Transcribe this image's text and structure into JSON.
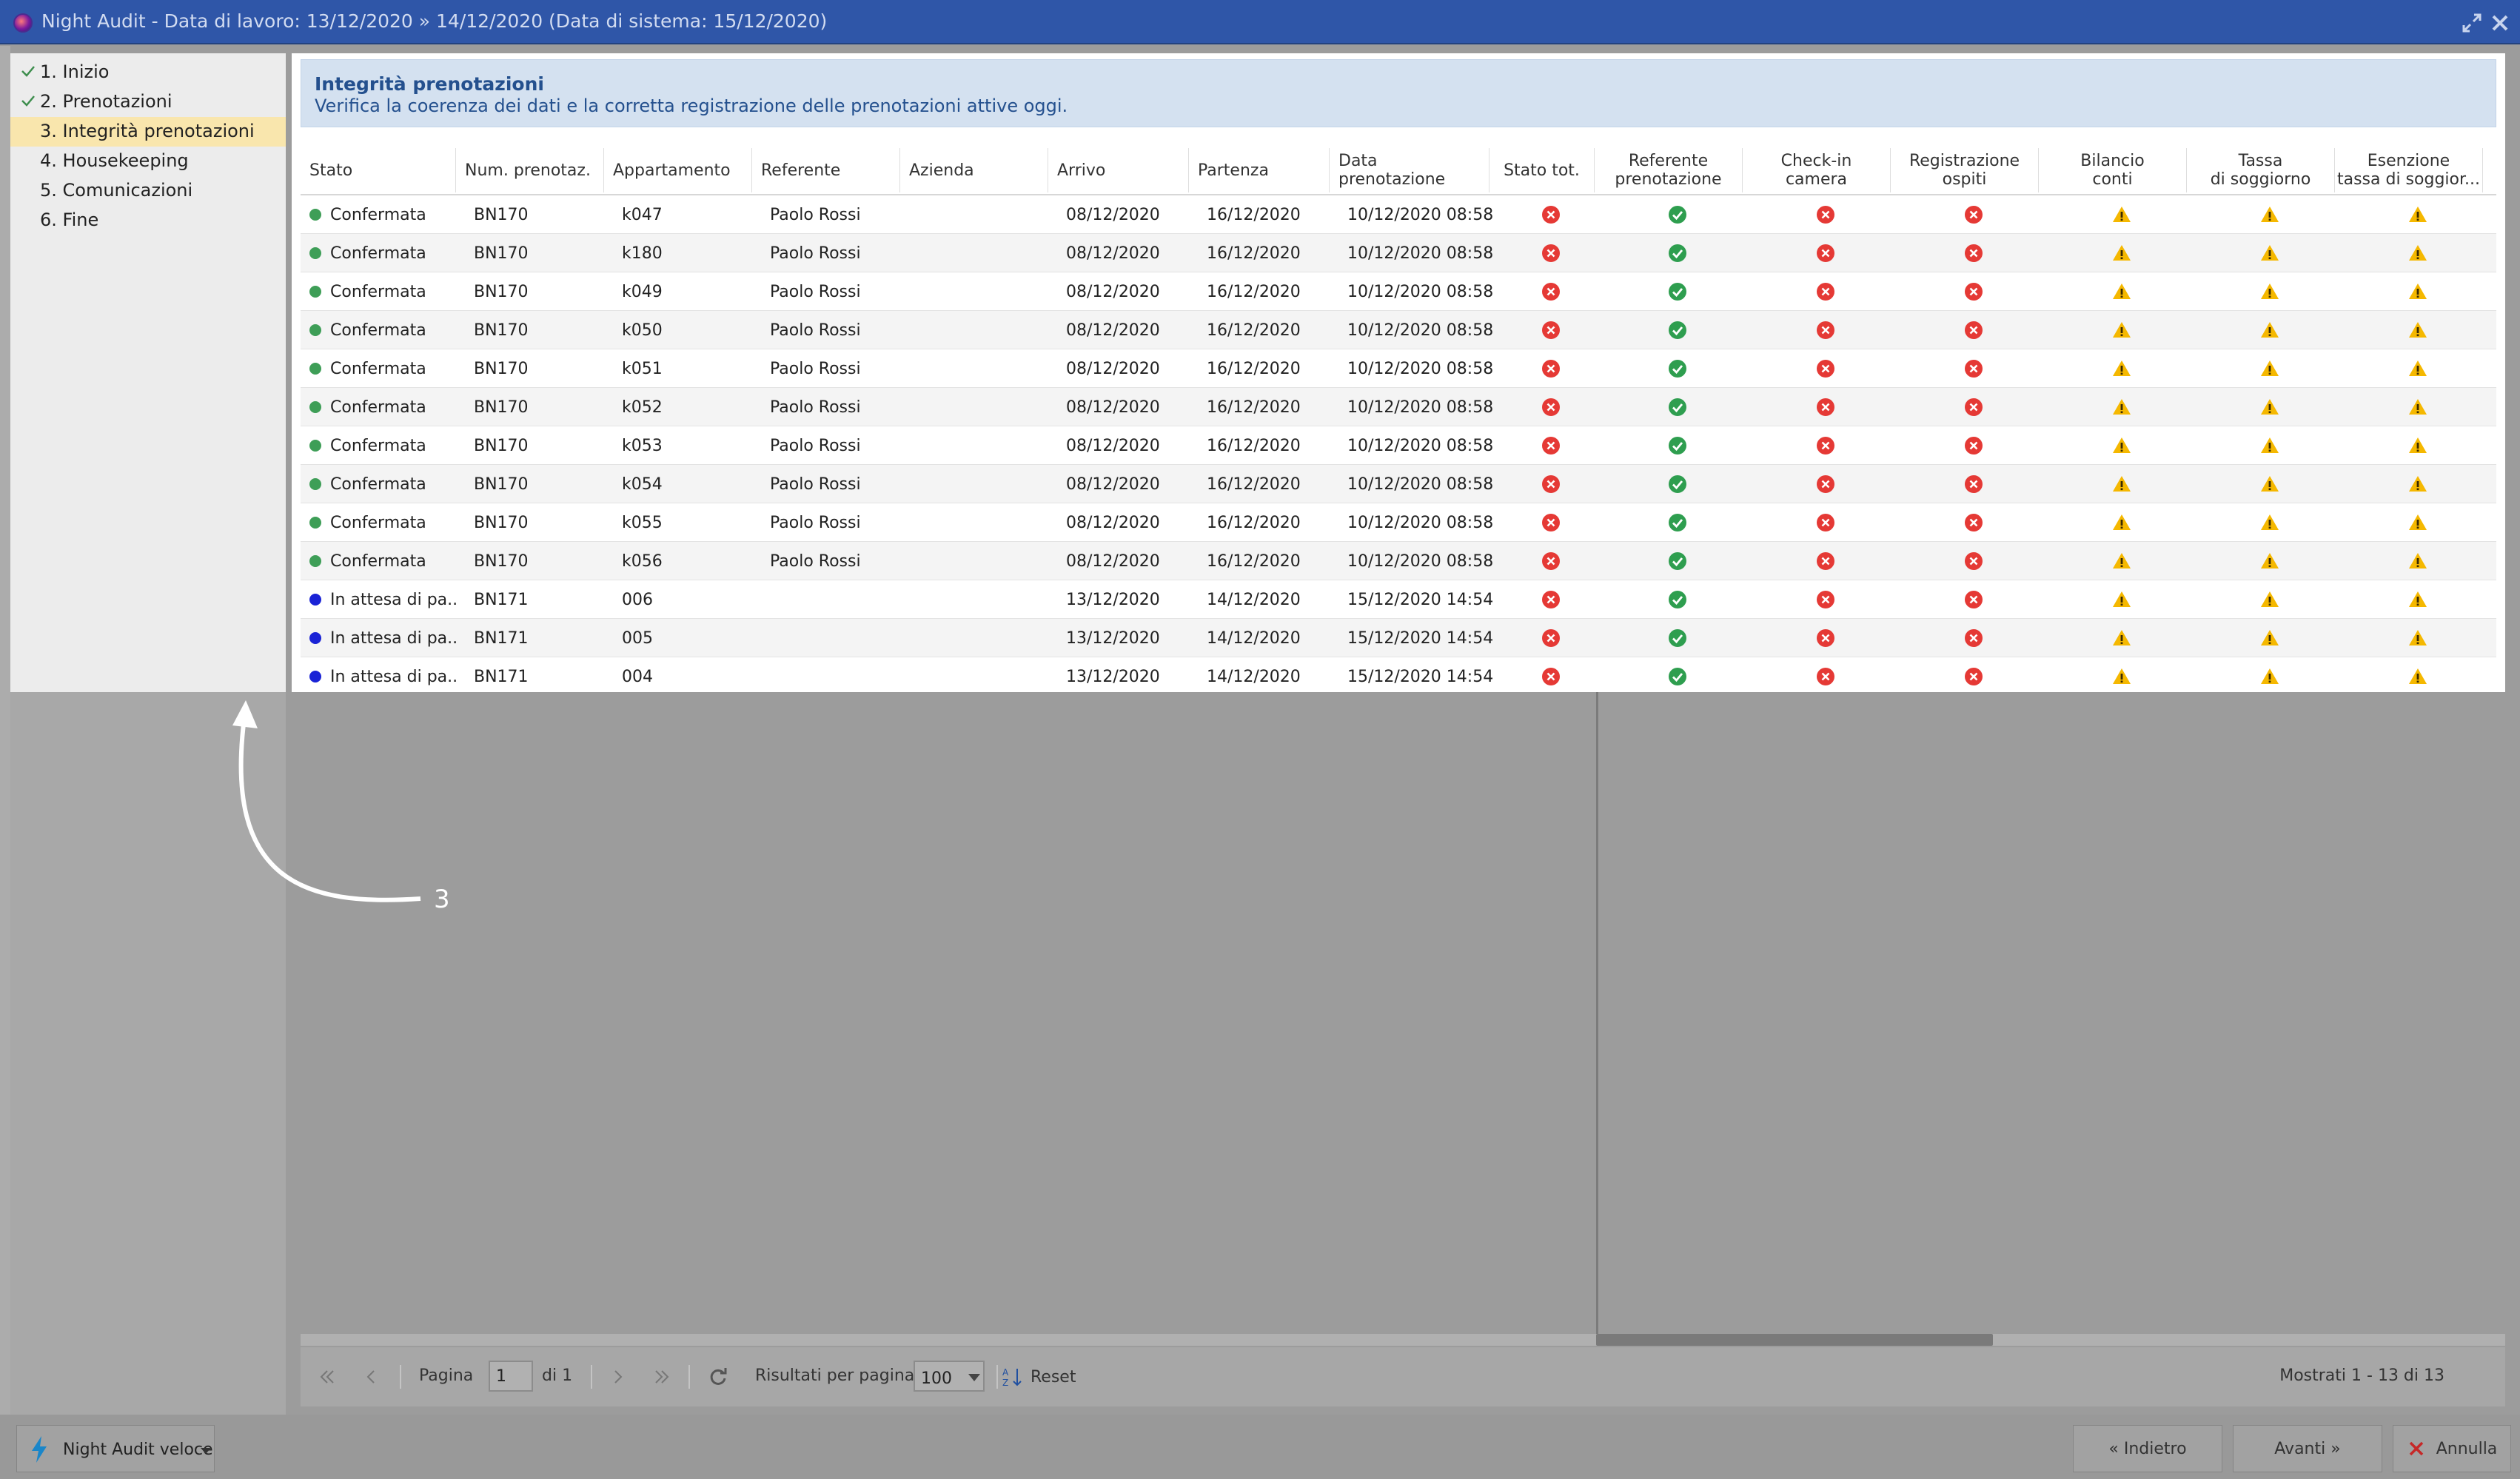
{
  "window": {
    "title": "Night Audit - Data di lavoro: 13/12/2020 » 14/12/2020 (Data di sistema: 15/12/2020)"
  },
  "sidebar": {
    "steps": [
      {
        "label": "1. Inizio",
        "done": true
      },
      {
        "label": "2. Prenotazioni",
        "done": true
      },
      {
        "label": "3. Integrità prenotazioni",
        "active": true
      },
      {
        "label": "4. Housekeeping"
      },
      {
        "label": "5. Comunicazioni"
      },
      {
        "label": "6. Fine"
      }
    ]
  },
  "info": {
    "title": "Integrità prenotazioni",
    "description": "Verifica la coerenza dei dati e la corretta registrazione delle prenotazioni attive oggi."
  },
  "table": {
    "headers": {
      "stato": "Stato",
      "num": "Num. prenotaz.",
      "appartamento": "Appartamento",
      "referente": "Referente",
      "azienda": "Azienda",
      "arrivo": "Arrivo",
      "partenza": "Partenza",
      "data_pren": "Data prenotazione",
      "stato_tot": "Stato tot.",
      "ref_pren": "Referente\nprenotazione",
      "checkin": "Check-in\ncamera",
      "reg_ospiti": "Registrazione\nospiti",
      "bilancio": "Bilancio\nconti",
      "tassa": "Tassa\ndi soggiorno",
      "esenzione": "Esenzione\ntassa di soggior..."
    },
    "rows": [
      {
        "stato": "Confermata",
        "stato_color": "#3e9e57",
        "num": "BN170",
        "appartamento": "k047",
        "referente": "Paolo Rossi",
        "azienda": "",
        "arrivo": "08/12/2020",
        "partenza": "16/12/2020",
        "data_pren": "10/12/2020 08:58",
        "stato_tot": "error",
        "ref_pren": "ok",
        "checkin": "error",
        "reg_ospiti": "error",
        "bilancio": "warning",
        "tassa": "warning",
        "esenzione": "warning"
      },
      {
        "stato": "Confermata",
        "stato_color": "#3e9e57",
        "num": "BN170",
        "appartamento": "k180",
        "referente": "Paolo Rossi",
        "azienda": "",
        "arrivo": "08/12/2020",
        "partenza": "16/12/2020",
        "data_pren": "10/12/2020 08:58",
        "stato_tot": "error",
        "ref_pren": "ok",
        "checkin": "error",
        "reg_ospiti": "error",
        "bilancio": "warning",
        "tassa": "warning",
        "esenzione": "warning"
      },
      {
        "stato": "Confermata",
        "stato_color": "#3e9e57",
        "num": "BN170",
        "appartamento": "k049",
        "referente": "Paolo Rossi",
        "azienda": "",
        "arrivo": "08/12/2020",
        "partenza": "16/12/2020",
        "data_pren": "10/12/2020 08:58",
        "stato_tot": "error",
        "ref_pren": "ok",
        "checkin": "error",
        "reg_ospiti": "error",
        "bilancio": "warning",
        "tassa": "warning",
        "esenzione": "warning"
      },
      {
        "stato": "Confermata",
        "stato_color": "#3e9e57",
        "num": "BN170",
        "appartamento": "k050",
        "referente": "Paolo Rossi",
        "azienda": "",
        "arrivo": "08/12/2020",
        "partenza": "16/12/2020",
        "data_pren": "10/12/2020 08:58",
        "stato_tot": "error",
        "ref_pren": "ok",
        "checkin": "error",
        "reg_ospiti": "error",
        "bilancio": "warning",
        "tassa": "warning",
        "esenzione": "warning"
      },
      {
        "stato": "Confermata",
        "stato_color": "#3e9e57",
        "num": "BN170",
        "appartamento": "k051",
        "referente": "Paolo Rossi",
        "azienda": "",
        "arrivo": "08/12/2020",
        "partenza": "16/12/2020",
        "data_pren": "10/12/2020 08:58",
        "stato_tot": "error",
        "ref_pren": "ok",
        "checkin": "error",
        "reg_ospiti": "error",
        "bilancio": "warning",
        "tassa": "warning",
        "esenzione": "warning"
      },
      {
        "stato": "Confermata",
        "stato_color": "#3e9e57",
        "num": "BN170",
        "appartamento": "k052",
        "referente": "Paolo Rossi",
        "azienda": "",
        "arrivo": "08/12/2020",
        "partenza": "16/12/2020",
        "data_pren": "10/12/2020 08:58",
        "stato_tot": "error",
        "ref_pren": "ok",
        "checkin": "error",
        "reg_ospiti": "error",
        "bilancio": "warning",
        "tassa": "warning",
        "esenzione": "warning"
      },
      {
        "stato": "Confermata",
        "stato_color": "#3e9e57",
        "num": "BN170",
        "appartamento": "k053",
        "referente": "Paolo Rossi",
        "azienda": "",
        "arrivo": "08/12/2020",
        "partenza": "16/12/2020",
        "data_pren": "10/12/2020 08:58",
        "stato_tot": "error",
        "ref_pren": "ok",
        "checkin": "error",
        "reg_ospiti": "error",
        "bilancio": "warning",
        "tassa": "warning",
        "esenzione": "warning"
      },
      {
        "stato": "Confermata",
        "stato_color": "#3e9e57",
        "num": "BN170",
        "appartamento": "k054",
        "referente": "Paolo Rossi",
        "azienda": "",
        "arrivo": "08/12/2020",
        "partenza": "16/12/2020",
        "data_pren": "10/12/2020 08:58",
        "stato_tot": "error",
        "ref_pren": "ok",
        "checkin": "error",
        "reg_ospiti": "error",
        "bilancio": "warning",
        "tassa": "warning",
        "esenzione": "warning"
      },
      {
        "stato": "Confermata",
        "stato_color": "#3e9e57",
        "num": "BN170",
        "appartamento": "k055",
        "referente": "Paolo Rossi",
        "azienda": "",
        "arrivo": "08/12/2020",
        "partenza": "16/12/2020",
        "data_pren": "10/12/2020 08:58",
        "stato_tot": "error",
        "ref_pren": "ok",
        "checkin": "error",
        "reg_ospiti": "error",
        "bilancio": "warning",
        "tassa": "warning",
        "esenzione": "warning"
      },
      {
        "stato": "Confermata",
        "stato_color": "#3e9e57",
        "num": "BN170",
        "appartamento": "k056",
        "referente": "Paolo Rossi",
        "azienda": "",
        "arrivo": "08/12/2020",
        "partenza": "16/12/2020",
        "data_pren": "10/12/2020 08:58",
        "stato_tot": "error",
        "ref_pren": "ok",
        "checkin": "error",
        "reg_ospiti": "error",
        "bilancio": "warning",
        "tassa": "warning",
        "esenzione": "warning"
      },
      {
        "stato": "In attesa di pa...",
        "stato_color": "#1a23d6",
        "num": "BN171",
        "appartamento": "006",
        "referente": "",
        "azienda": "",
        "arrivo": "13/12/2020",
        "partenza": "14/12/2020",
        "data_pren": "15/12/2020 14:54",
        "stato_tot": "error",
        "ref_pren": "ok",
        "checkin": "error",
        "reg_ospiti": "error",
        "bilancio": "warning",
        "tassa": "warning",
        "esenzione": "warning"
      },
      {
        "stato": "In attesa di pa...",
        "stato_color": "#1a23d6",
        "num": "BN171",
        "appartamento": "005",
        "referente": "",
        "azienda": "",
        "arrivo": "13/12/2020",
        "partenza": "14/12/2020",
        "data_pren": "15/12/2020 14:54",
        "stato_tot": "error",
        "ref_pren": "ok",
        "checkin": "error",
        "reg_ospiti": "error",
        "bilancio": "warning",
        "tassa": "warning",
        "esenzione": "warning"
      },
      {
        "stato": "In attesa di pa...",
        "stato_color": "#1a23d6",
        "num": "BN171",
        "appartamento": "004",
        "referente": "",
        "azienda": "",
        "arrivo": "13/12/2020",
        "partenza": "14/12/2020",
        "data_pren": "15/12/2020 14:54",
        "stato_tot": "error",
        "ref_pren": "ok",
        "checkin": "error",
        "reg_ospiti": "error",
        "bilancio": "warning",
        "tassa": "warning",
        "esenzione": "warning"
      }
    ]
  },
  "pager": {
    "page_label": "Pagina",
    "page_value": "1",
    "of_label": "di 1",
    "per_page_label": "Risultati per pagina",
    "per_page_value": "100",
    "reset_label": "Reset",
    "summary": "Mostrati 1 - 13 di 13"
  },
  "footer": {
    "quick_label": "Night Audit veloce",
    "back_label": "« Indietro",
    "next_label": "Avanti »",
    "cancel_label": "Annulla"
  },
  "callout": {
    "number": "3"
  },
  "colors": {
    "titlebar": "#2f56a8",
    "active_step": "#f9e6ad",
    "ok": "#2e9e4f",
    "error": "#e53935",
    "warning": "#f5b800"
  }
}
